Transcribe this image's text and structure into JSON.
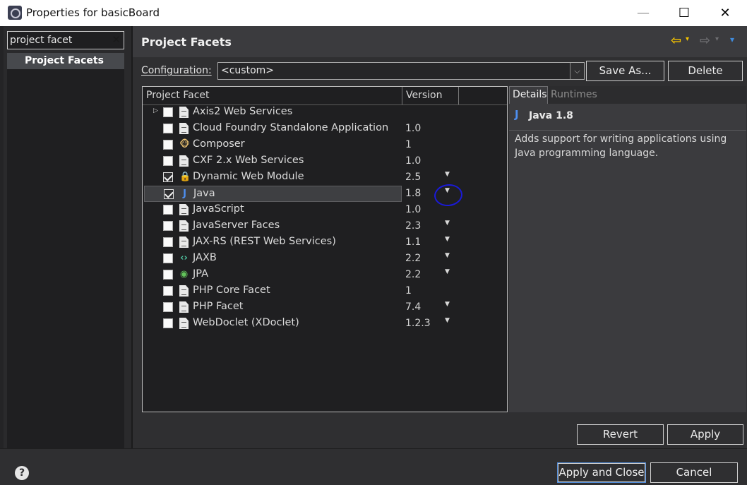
{
  "window": {
    "title": "Properties for basicBoard",
    "minimize": "—",
    "maximize": "☐",
    "close": "✕"
  },
  "sidebar": {
    "filter_value": "project facet",
    "filter_clear": "✕",
    "selected_item": "Project Facets"
  },
  "header": {
    "title": "Project Facets",
    "back": "⇦",
    "forward": "⇨",
    "menu_arrow": "▾"
  },
  "configuration": {
    "label": "Configuration:",
    "value": "<custom>",
    "save_as": "Save As...",
    "delete": "Delete"
  },
  "table": {
    "headers": {
      "facet": "Project Facet",
      "version": "Version"
    },
    "rows": [
      {
        "name": "Axis2 Web Services",
        "version": "",
        "checked": false,
        "expandable": true,
        "dropdown": false,
        "icon": "doc-icon",
        "selected": false
      },
      {
        "name": "Cloud Foundry Standalone Application",
        "version": "1.0",
        "checked": false,
        "expandable": false,
        "dropdown": false,
        "icon": "doc-icon",
        "selected": false
      },
      {
        "name": "Composer",
        "version": "1",
        "checked": false,
        "expandable": false,
        "dropdown": false,
        "icon": "composer-icon",
        "selected": false
      },
      {
        "name": "CXF 2.x Web Services",
        "version": "1.0",
        "checked": false,
        "expandable": false,
        "dropdown": false,
        "icon": "doc-icon",
        "selected": false
      },
      {
        "name": "Dynamic Web Module",
        "version": "2.5",
        "checked": true,
        "expandable": false,
        "dropdown": true,
        "icon": "web-module-icon",
        "selected": false
      },
      {
        "name": "Java",
        "version": "1.8",
        "checked": true,
        "expandable": false,
        "dropdown": true,
        "icon": "java-icon",
        "selected": true
      },
      {
        "name": "JavaScript",
        "version": "1.0",
        "checked": false,
        "expandable": false,
        "dropdown": false,
        "icon": "doc-icon",
        "selected": false
      },
      {
        "name": "JavaServer Faces",
        "version": "2.3",
        "checked": false,
        "expandable": false,
        "dropdown": true,
        "icon": "doc-icon",
        "selected": false
      },
      {
        "name": "JAX-RS (REST Web Services)",
        "version": "1.1",
        "checked": false,
        "expandable": false,
        "dropdown": true,
        "icon": "doc-icon",
        "selected": false
      },
      {
        "name": "JAXB",
        "version": "2.2",
        "checked": false,
        "expandable": false,
        "dropdown": true,
        "icon": "jaxb-icon",
        "selected": false
      },
      {
        "name": "JPA",
        "version": "2.2",
        "checked": false,
        "expandable": false,
        "dropdown": true,
        "icon": "jpa-icon",
        "selected": false
      },
      {
        "name": "PHP Core Facet",
        "version": "1",
        "checked": false,
        "expandable": false,
        "dropdown": false,
        "icon": "doc-icon",
        "selected": false
      },
      {
        "name": "PHP Facet",
        "version": "7.4",
        "checked": false,
        "expandable": false,
        "dropdown": true,
        "icon": "doc-icon",
        "selected": false
      },
      {
        "name": "WebDoclet (XDoclet)",
        "version": "1.2.3",
        "checked": false,
        "expandable": false,
        "dropdown": true,
        "icon": "doc-icon",
        "selected": false
      }
    ]
  },
  "details": {
    "tab_details": "Details",
    "tab_runtimes": "Runtimes",
    "icon_glyph": "J",
    "title": "Java 1.8",
    "description": "Adds support for writing applications using Java programming language."
  },
  "buttons": {
    "revert": "Revert",
    "apply": "Apply",
    "apply_and_close": "Apply and Close",
    "cancel": "Cancel",
    "help": "?"
  },
  "colors": {
    "accent": "#4f8bd9",
    "annotation": "#1a1ad8",
    "nav_back": "#f6c400"
  }
}
